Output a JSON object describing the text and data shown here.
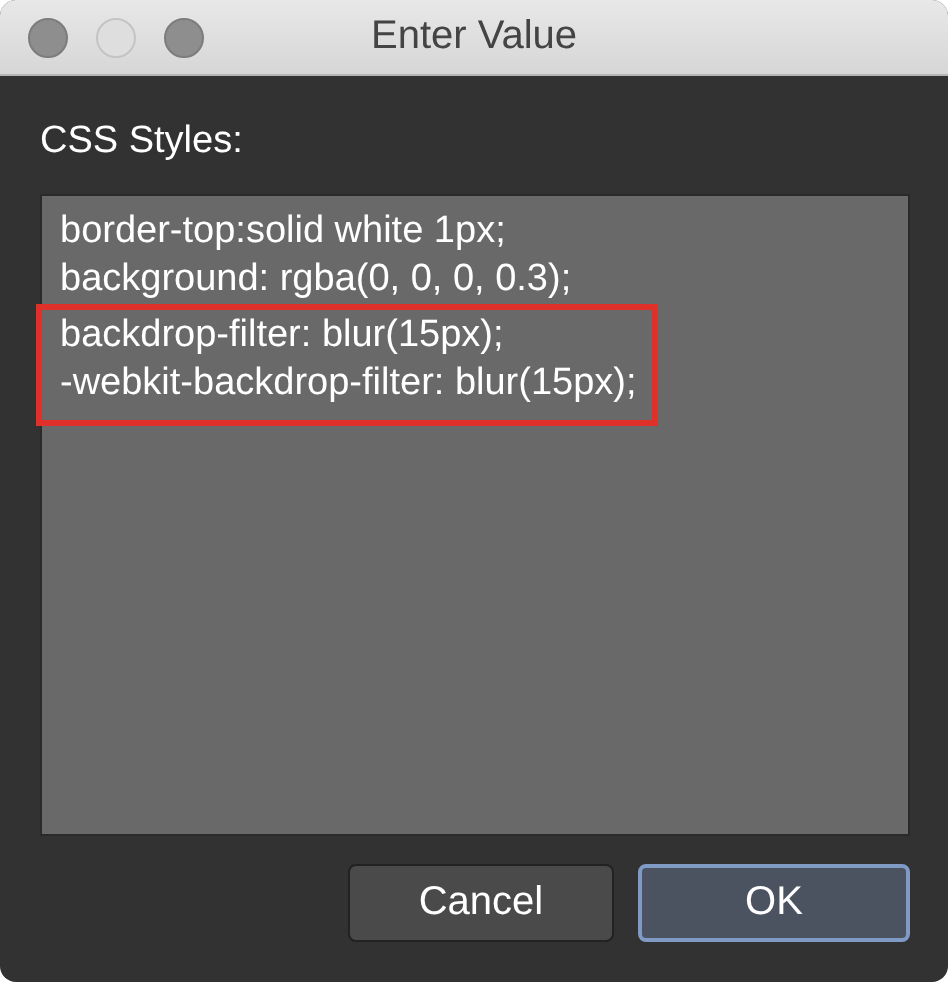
{
  "window": {
    "title": "Enter Value",
    "controls": [
      {
        "disabled": false
      },
      {
        "disabled": true
      },
      {
        "disabled": false
      }
    ]
  },
  "field_label": "CSS Styles:",
  "text_area": {
    "lines": [
      {
        "text": "border-top:solid white 1px;",
        "highlighted": false
      },
      {
        "text": "background: rgba(0, 0, 0, 0.3);",
        "highlighted": false
      },
      {
        "text": "backdrop-filter: blur(15px);",
        "highlighted": true
      },
      {
        "text": "-webkit-backdrop-filter: blur(15px);",
        "highlighted": true
      }
    ]
  },
  "buttons": [
    {
      "label": "Cancel",
      "default": false
    },
    {
      "label": "OK",
      "default": true
    }
  ]
}
